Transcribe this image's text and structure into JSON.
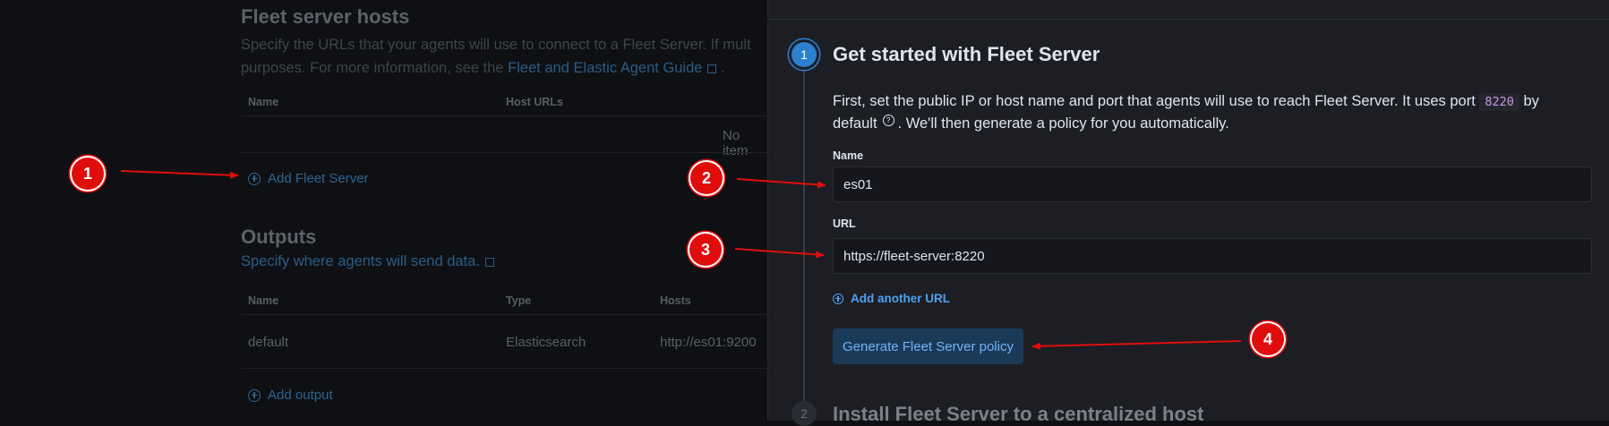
{
  "background": {
    "fleet_hosts": {
      "title": "Fleet server hosts",
      "desc_line1": "Specify the URLs that your agents will use to connect to a Fleet Server. If mult",
      "desc_line2_prefix": "purposes. For more information, see the ",
      "desc_link": "Fleet and Elastic Agent Guide",
      "desc_line2_suffix": ".",
      "col_name": "Name",
      "col_host_urls": "Host URLs",
      "empty_text": "No item",
      "add_label": "Add Fleet Server"
    },
    "outputs": {
      "title": "Outputs",
      "desc_link": "Specify where agents will send data.",
      "col_name": "Name",
      "col_type": "Type",
      "col_hosts": "Hosts",
      "row": {
        "name": "default",
        "type": "Elasticsearch",
        "hosts": "http://es01:9200"
      },
      "add_label": "Add output"
    }
  },
  "flyout": {
    "step1": {
      "number": "1",
      "title": "Get started with Fleet Server",
      "desc_part1": "First, set the public IP or host name and port that agents will use to reach Fleet Server. It uses port ",
      "port_code": "8220",
      "desc_part2": " by",
      "desc_part3": "default",
      "desc_part4": ". We'll then generate a policy for you automatically.",
      "name_label": "Name",
      "name_value": "es01",
      "url_label": "URL",
      "url_value": "https://fleet-server:8220",
      "add_url_label": "Add another URL",
      "generate_label": "Generate Fleet Server policy"
    },
    "step2": {
      "number": "2",
      "title": "Install Fleet Server to a centralized host"
    }
  },
  "annotations": {
    "markers": [
      "1",
      "2",
      "3",
      "4"
    ],
    "color": "#e00d0d"
  }
}
